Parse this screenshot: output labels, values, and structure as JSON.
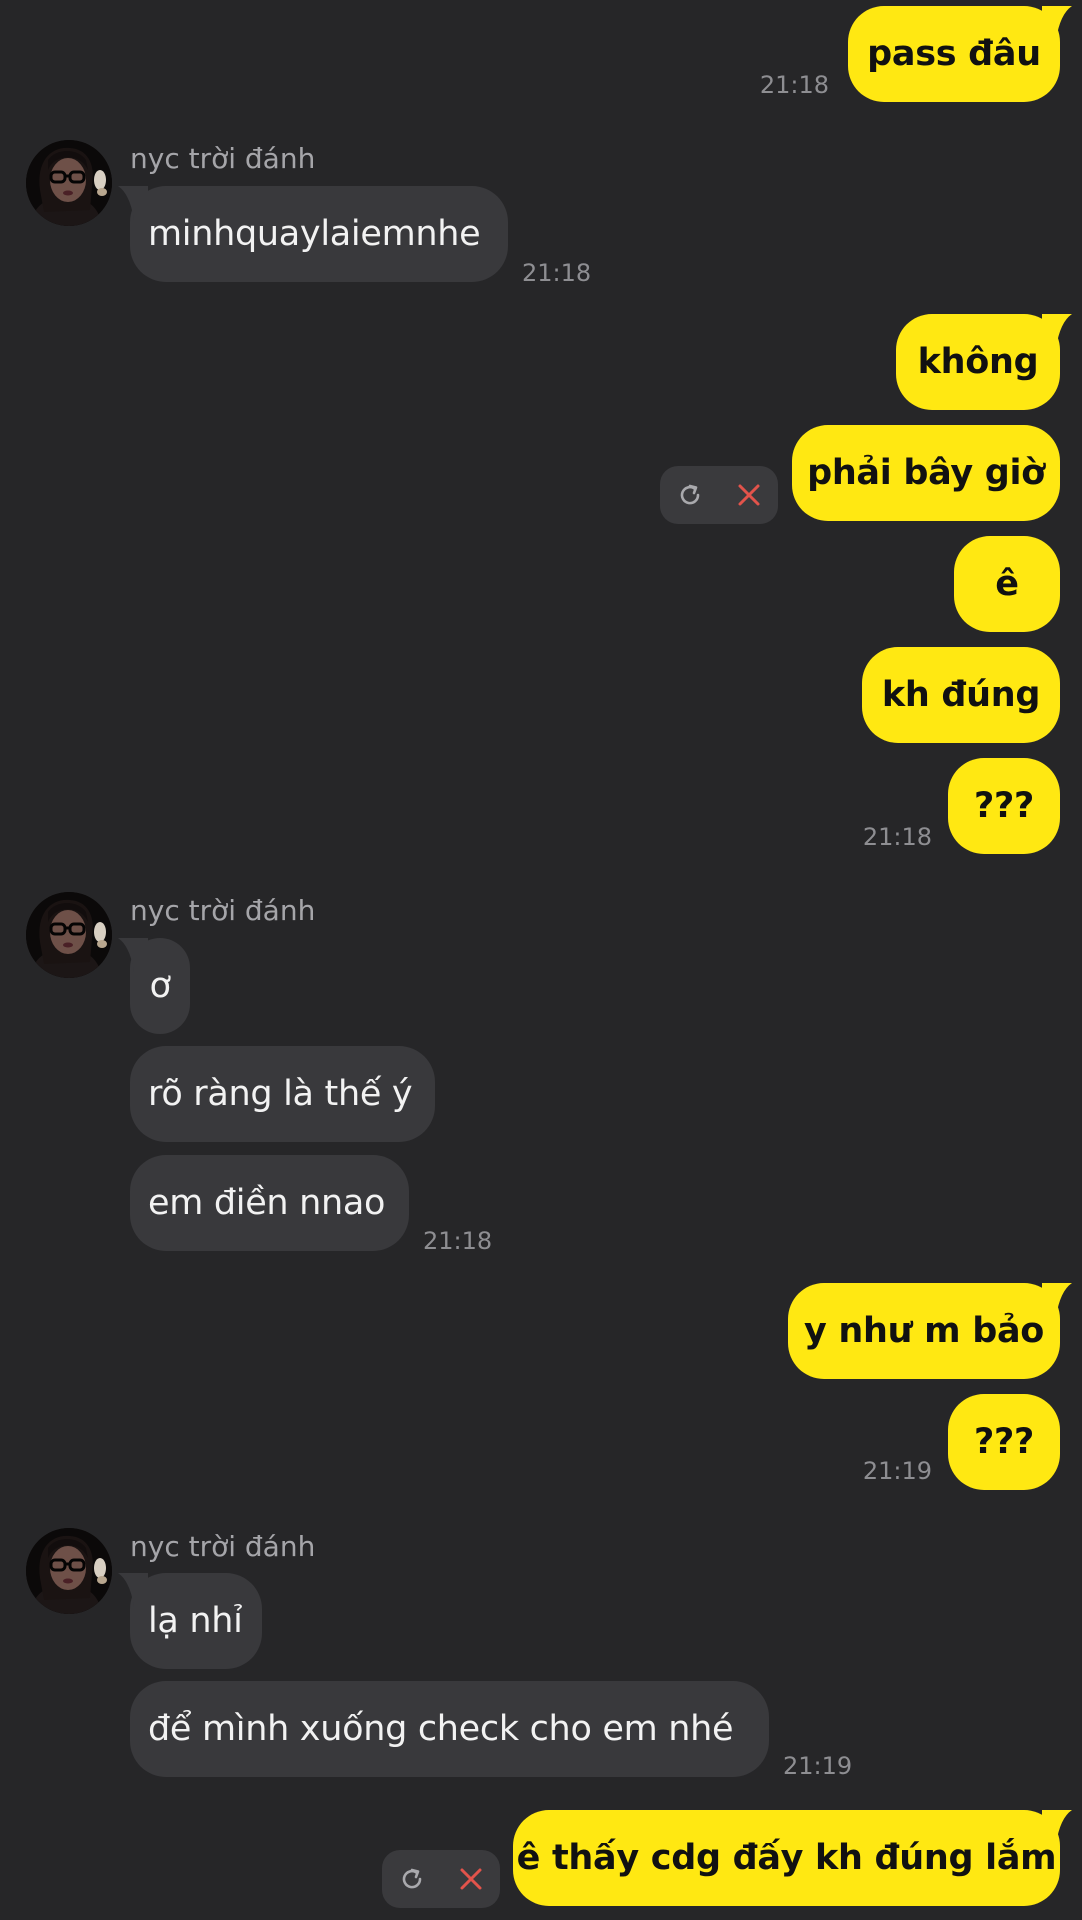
{
  "chat": {
    "contact_name": "nyc trời đánh",
    "colors": {
      "background": "#262628",
      "my_bubble": "#FFE812",
      "their_bubble": "#39393C",
      "timestamp": "#8E8E92",
      "cancel_icon": "#E2534B"
    },
    "icons": {
      "retry": "refresh-icon",
      "cancel": "close-icon"
    },
    "messages": [
      {
        "from": "me",
        "text": "pass đâu",
        "time": "21:18"
      },
      {
        "from": "them",
        "sender": "nyc trời đánh",
        "text": "minhquaylaiemnhe",
        "time": "21:18"
      },
      {
        "from": "me",
        "text": "không"
      },
      {
        "from": "me",
        "text": "phải bây giờ",
        "status": "failed"
      },
      {
        "from": "me",
        "text": "ê"
      },
      {
        "from": "me",
        "text": "kh đúng"
      },
      {
        "from": "me",
        "text": "???",
        "time": "21:18"
      },
      {
        "from": "them",
        "sender": "nyc trời đánh",
        "text": "ơ"
      },
      {
        "from": "them",
        "text": "rõ ràng là thế ý"
      },
      {
        "from": "them",
        "text": "em điền nnao",
        "time": "21:18"
      },
      {
        "from": "me",
        "text": "y như m bảo"
      },
      {
        "from": "me",
        "text": "???",
        "time": "21:19"
      },
      {
        "from": "them",
        "sender": "nyc trời đánh",
        "text": "lạ nhỉ"
      },
      {
        "from": "them",
        "text": "để mình xuống check cho em nhé",
        "time": "21:19"
      },
      {
        "from": "me",
        "text": "ê thấy cdg đấy kh đúng lắm",
        "status": "failed"
      }
    ]
  }
}
